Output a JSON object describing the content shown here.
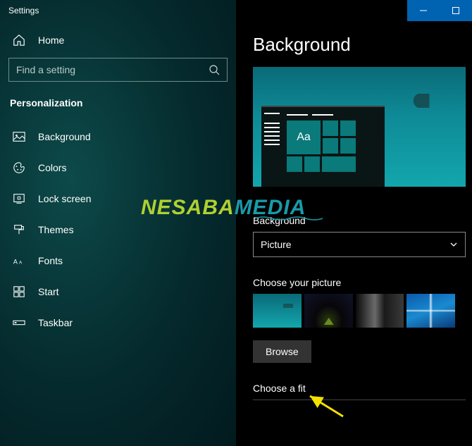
{
  "titlebar": {
    "title": "Settings"
  },
  "sidebar": {
    "home_label": "Home",
    "search_placeholder": "Find a setting",
    "category": "Personalization",
    "items": [
      {
        "icon": "picture-icon",
        "label": "Background"
      },
      {
        "icon": "palette-icon",
        "label": "Colors"
      },
      {
        "icon": "lock-icon",
        "label": "Lock screen"
      },
      {
        "icon": "paint-icon",
        "label": "Themes"
      },
      {
        "icon": "font-icon",
        "label": "Fonts"
      },
      {
        "icon": "start-icon",
        "label": "Start"
      },
      {
        "icon": "taskbar-icon",
        "label": "Taskbar"
      }
    ]
  },
  "content": {
    "page_title": "Background",
    "preview_tile_text": "Aa",
    "bg_dropdown": {
      "label": "Background",
      "value": "Picture"
    },
    "choose_picture_label": "Choose your picture",
    "browse_label": "Browse",
    "choose_fit_label": "Choose a fit"
  },
  "watermark": {
    "a": "NESABA",
    "b": "MEDIA"
  },
  "colors": {
    "accent": "#0063b1",
    "teal": "#0a7a7a"
  }
}
